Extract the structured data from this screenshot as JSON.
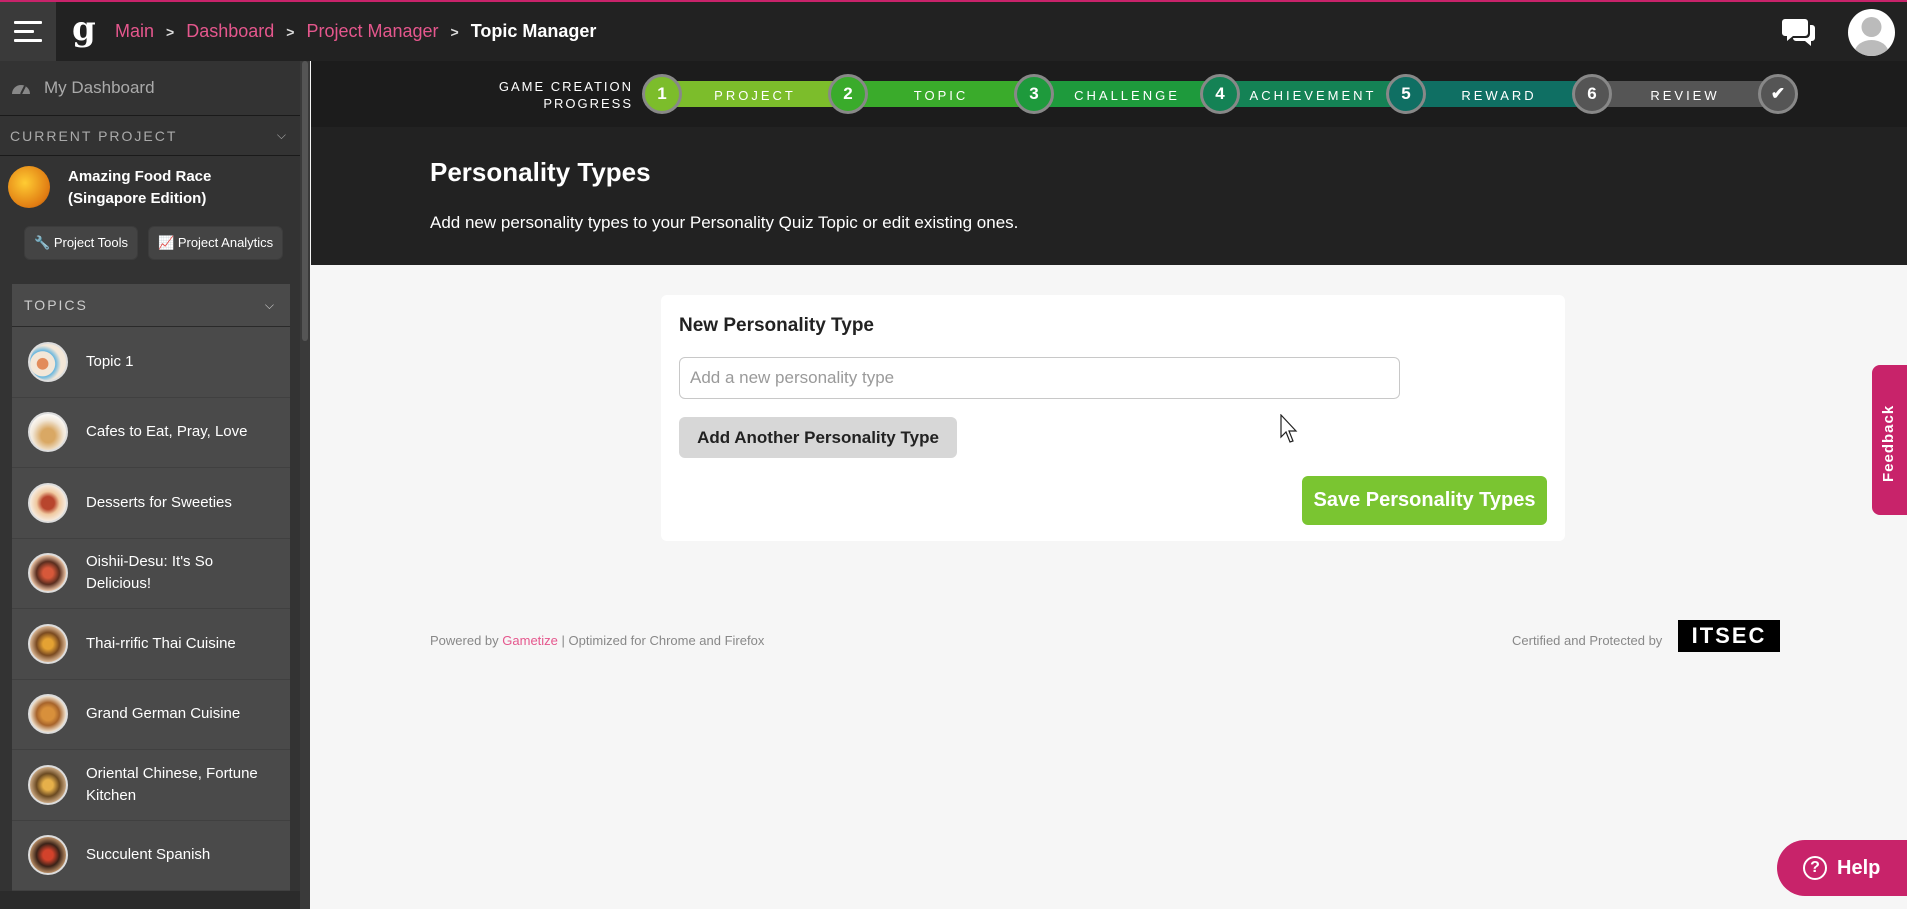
{
  "header": {
    "breadcrumbs": [
      "Main",
      "Dashboard",
      "Project Manager"
    ],
    "current": "Topic Manager"
  },
  "sidebar": {
    "dashboard_label": "My Dashboard",
    "current_project_label": "CURRENT PROJECT",
    "project_name": "Amazing Food Race (Singapore Edition)",
    "project_tools_label": "Project Tools",
    "project_analytics_label": "Project Analytics",
    "topics_label": "TOPICS",
    "topics": [
      {
        "label": "Topic 1"
      },
      {
        "label": "Cafes to Eat, Pray, Love"
      },
      {
        "label": "Desserts for Sweeties"
      },
      {
        "label": "Oishii-Desu: It's So Delicious!"
      },
      {
        "label": "Thai-rrific Thai Cuisine"
      },
      {
        "label": "Grand German Cuisine"
      },
      {
        "label": "Oriental Chinese, Fortune Kitchen"
      },
      {
        "label": "Succulent Spanish"
      }
    ]
  },
  "progress": {
    "title": "GAME CREATION PROGRESS",
    "steps": [
      {
        "number": "1",
        "label": "PROJECT",
        "color": "#7cbd2b"
      },
      {
        "number": "2",
        "label": "TOPIC",
        "color": "#3aab2b"
      },
      {
        "number": "3",
        "label": "CHALLENGE",
        "color": "#1e9a3c"
      },
      {
        "number": "4",
        "label": "ACHIEVEMENT",
        "color": "#148255"
      },
      {
        "number": "5",
        "label": "REWARD",
        "color": "#0f6f63"
      },
      {
        "number": "6",
        "label": "REVIEW",
        "color": "#555555"
      }
    ]
  },
  "page": {
    "title": "Personality Types",
    "description": "Add new personality types to your Personality Quiz Topic or edit existing ones."
  },
  "form": {
    "title": "New Personality Type",
    "input_placeholder": "Add a new personality type",
    "input_value": "",
    "add_button": "Add Another Personality Type",
    "save_button": "Save Personality Types"
  },
  "footer": {
    "powered_by": "Powered by",
    "brand": "Gametize",
    "optimized": "| Optimized for Chrome and Firefox",
    "certified": "Certified and Protected by",
    "itsec": "ITSEC"
  },
  "feedback_label": "Feedback",
  "help_label": "Help",
  "colors": {
    "accent": "#c8236a",
    "link": "#e5578d",
    "save_green": "#7ac531",
    "dark": "#222222"
  }
}
